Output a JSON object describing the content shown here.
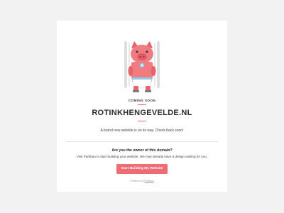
{
  "page": {
    "coming_soon": "COMING SOON",
    "domain": "ROTINKHENGEVELDE.NL",
    "tagline": "A brand new website is on its way. Check back soon!",
    "owner_question": "Are you the owner of this domain?",
    "owner_text": "Visit Parkban to start building your website. We may already have a design waiting for you.",
    "cta_label": "Start Building My Website",
    "powered_prefix": "Powered by",
    "powered_link": "Parkban"
  },
  "colors": {
    "accent": "#ef6c74",
    "background": "#f2f2f2",
    "card": "#ffffff",
    "pig_body": "#f07c82",
    "diaper": "#ffffff",
    "stroller_frame": "#d4d6d9"
  },
  "illustration": {
    "icon": "baby-pig-icon"
  }
}
